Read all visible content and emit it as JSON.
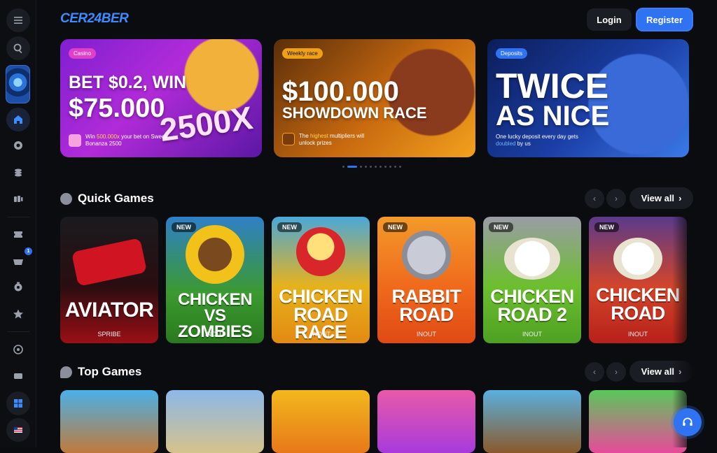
{
  "header": {
    "logo_main": "CER24BER",
    "login": "Login",
    "register": "Register"
  },
  "banners": [
    {
      "tag": "Casino",
      "line1": "BET $0.2, WIN",
      "line2": "$75.000",
      "badge": "2500X",
      "sub_prefix": "Win ",
      "sub_highlight": "500.000x",
      "sub_rest": " your bet on Sweet Bonanza 2500",
      "accent": "#ff5ad7"
    },
    {
      "tag": "Weekly race",
      "line1": "$100.000",
      "line2": "SHOWDOWN RACE",
      "sub_prefix": "The ",
      "sub_highlight": "highest",
      "sub_rest": " multipliers will unlock prizes",
      "accent": "#ffb11a"
    },
    {
      "tag": "Deposits",
      "line1": "TWICE",
      "line2": "AS NICE",
      "sub_prefix": "One lucky deposit every day gets ",
      "sub_highlight": "doubled",
      "sub_rest": " by us",
      "accent": "#2f72f2"
    }
  ],
  "carousel": {
    "count": 11,
    "active": 1
  },
  "quick_games": {
    "title": "Quick Games",
    "view_all": "View all",
    "cards": [
      {
        "name": "AVIATOR",
        "provider": "SPRIBE",
        "new": "",
        "color": "#b5121b"
      },
      {
        "name": "CHICKEN VS ZOMBIES",
        "provider": "INOUT",
        "new": "NEW",
        "color": "#3f8f26"
      },
      {
        "name": "CHICKEN ROAD RACE",
        "provider": "INOUT",
        "new": "NEW",
        "color": "#e4a81a"
      },
      {
        "name": "RABBIT ROAD",
        "provider": "INOUT",
        "new": "NEW",
        "color": "#f0601c"
      },
      {
        "name": "CHICKEN ROAD 2",
        "provider": "INOUT",
        "new": "NEW",
        "color": "#6ab82b"
      },
      {
        "name": "CHICKEN ROAD",
        "provider": "INOUT",
        "new": "NEW",
        "color": "#d93a22"
      }
    ]
  },
  "top_games": {
    "title": "Top Games",
    "view_all": "View all"
  }
}
